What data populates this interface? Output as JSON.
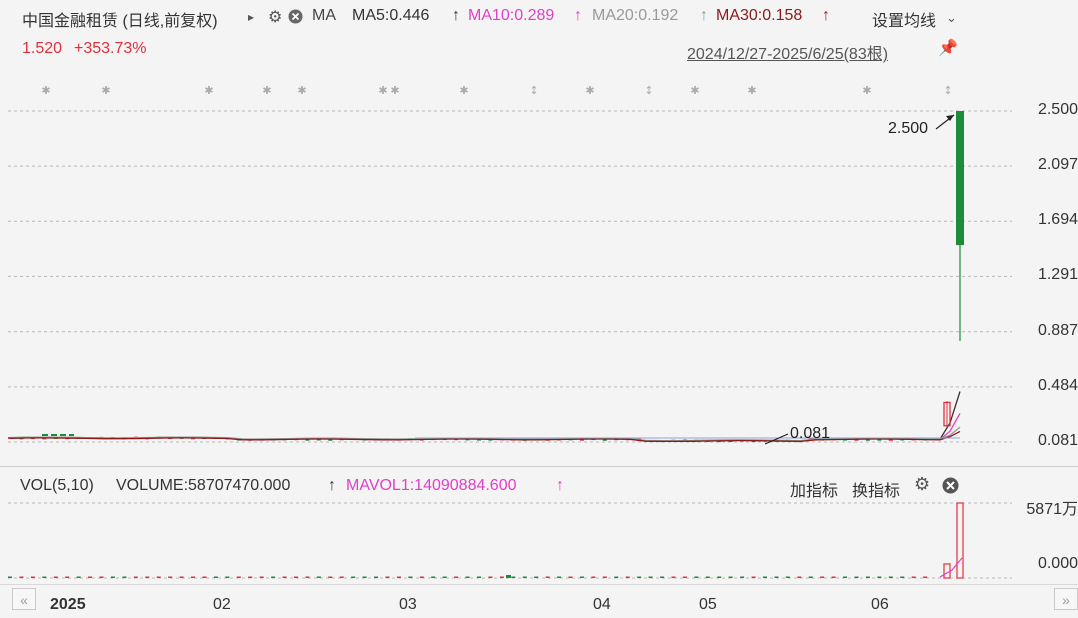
{
  "header": {
    "title": "中国金融租赁 (日线,前复权)",
    "ma_label": "MA",
    "ma5": "MA5:0.446",
    "ma10": "MA10:0.289",
    "ma20": "MA20:0.192",
    "ma30": "MA30:0.158",
    "settings": "设置均线",
    "price": "1.520",
    "change": "+353.73%",
    "range": "2024/12/27-2025/6/25(83根)"
  },
  "volume": {
    "label": "VOL(5,10)",
    "volume": "VOLUME:58707470.000",
    "mavol": "MAVOL1:14090884.600",
    "add_indicator": "加指标",
    "switch_indicator": "换指标",
    "ytick_top": "5871万",
    "ytick_bottom": "0.000"
  },
  "colors": {
    "up": "#e0303c",
    "down": "#1a8c3a",
    "ma5": "#333333",
    "ma10": "#e040c8",
    "ma20": "#999999",
    "ma30": "#8b1a1a"
  },
  "chart_data": {
    "type": "candlestick",
    "y_ticks": [
      "2.500",
      "2.097",
      "1.694",
      "1.291",
      "0.887",
      "0.484",
      "0.081"
    ],
    "ylim": [
      0.081,
      2.5
    ],
    "x_ticks": [
      "2025",
      "02",
      "03",
      "04",
      "05",
      "06"
    ],
    "annotations": [
      {
        "text": "2.500",
        "value": 2.5
      },
      {
        "text": "0.081",
        "value": 0.081
      }
    ],
    "grid": true,
    "last_candle": {
      "open": 2.5,
      "high": 2.5,
      "close": 1.52,
      "low": 0.82
    },
    "prev_candle": {
      "open": 0.2,
      "close": 0.37,
      "high": 0.38,
      "low": 0.19
    },
    "baseline_price": 0.1,
    "volume": {
      "max": 58707470,
      "last": 58707470,
      "prev": 11000000
    }
  }
}
